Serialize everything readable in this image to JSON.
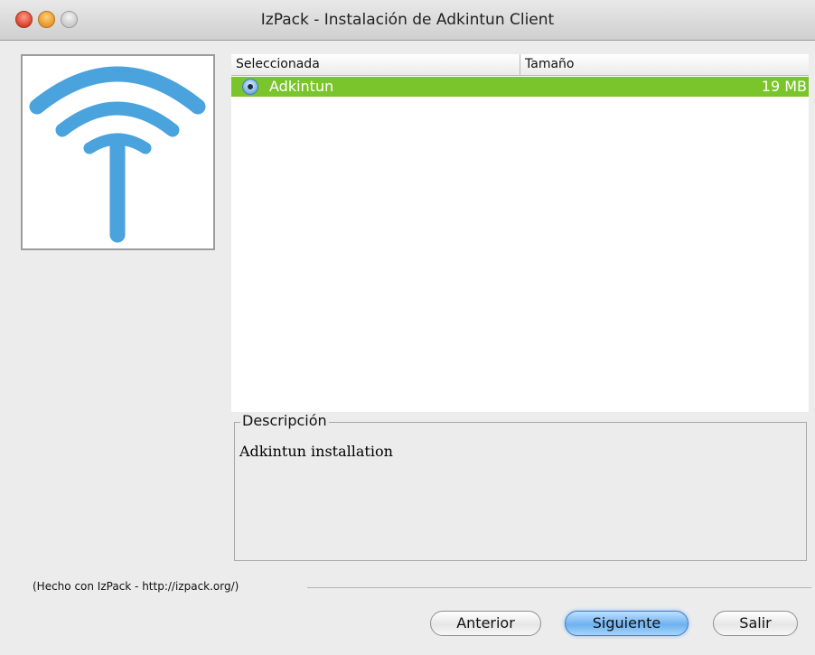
{
  "window": {
    "title": "IzPack - Instalación de Adkintun Client"
  },
  "table": {
    "headers": {
      "selected": "Seleccionada",
      "size": "Tamaño"
    },
    "rows": [
      {
        "name": "Adkintun",
        "size": "19 MB",
        "selected": true
      }
    ]
  },
  "description": {
    "legend": "Descripción",
    "text": "Adkintun installation"
  },
  "footer": {
    "made_with": "(Hecho con IzPack - http://izpack.org/)"
  },
  "buttons": {
    "previous": "Anterior",
    "next": "Siguiente",
    "exit": "Salir"
  },
  "colors": {
    "selection": "#7ac52b",
    "logo": "#4aa3dd"
  },
  "icons": {
    "logo": "signal-antenna-icon",
    "radio": "radio-selected-icon"
  }
}
